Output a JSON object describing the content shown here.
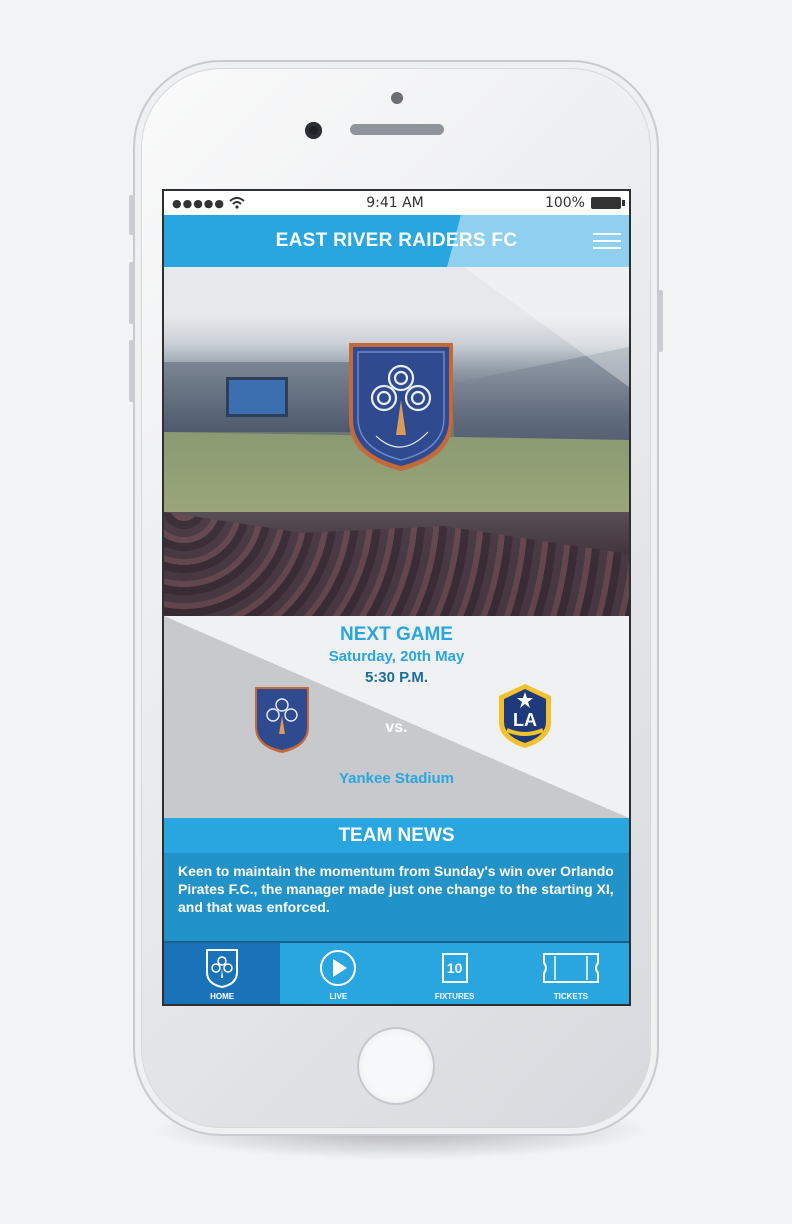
{
  "status_bar": {
    "signal": "●●●●●",
    "time": "9:41 AM",
    "battery": "100%"
  },
  "header": {
    "title": "EAST RIVER RAIDERS FC",
    "menu_icon": "hamburger-menu-icon"
  },
  "hero": {
    "crest_icon": "east-river-raiders-crest"
  },
  "next_game": {
    "title": "NEXT GAME",
    "date": "Saturday, 20th May",
    "time": "5:30 P.M.",
    "vs": "vs.",
    "venue": "Yankee Stadium",
    "home_logo": "east-river-raiders-crest",
    "away_logo": "la-galaxy-crest",
    "away_logo_text": "LA"
  },
  "team_news": {
    "title": "TEAM NEWS",
    "body": "Keen to maintain the momentum from Sunday's win over Orlando Pirates F.C., the manager made just one change to the starting XI, and that was enforced."
  },
  "tabs": [
    {
      "label": "HOME",
      "icon": "crest-icon",
      "active": true
    },
    {
      "label": "LIVE",
      "icon": "play-icon",
      "active": false
    },
    {
      "label": "FIXTURES",
      "icon": "calendar-icon",
      "value": "10",
      "active": false
    },
    {
      "label": "TICKETS",
      "icon": "ticket-icon",
      "active": false
    }
  ],
  "colors": {
    "accent": "#29a6e0",
    "accent_dark": "#1a73b8",
    "news_bg": "#2293c8"
  }
}
